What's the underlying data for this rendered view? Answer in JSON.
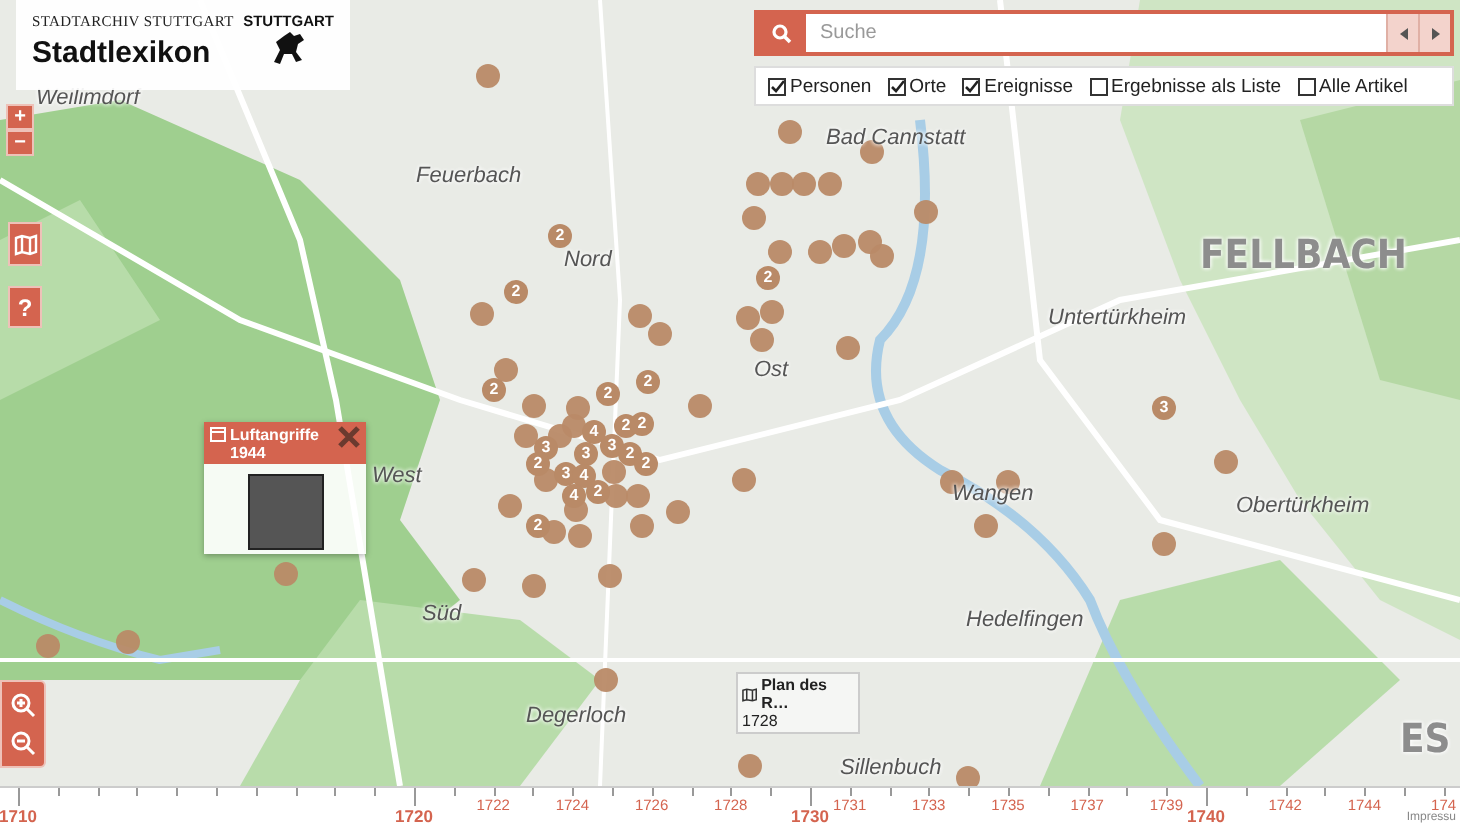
{
  "header": {
    "subtitle": "STADTARCHIV STUTTGART",
    "title": "Stadtlexikon",
    "logo_text": "STUTTGART"
  },
  "map_controls": {
    "zoom_in": "+",
    "zoom_out": "−",
    "help": "?"
  },
  "search": {
    "placeholder": "Suche"
  },
  "filters": [
    {
      "label": "Personen",
      "checked": true
    },
    {
      "label": "Orte",
      "checked": true
    },
    {
      "label": "Ereignisse",
      "checked": true
    },
    {
      "label": "Ergebnisse als Liste",
      "checked": false
    },
    {
      "label": "Alle Artikel",
      "checked": false
    }
  ],
  "place_labels": [
    {
      "text": "Weilimdorf",
      "kind": "district"
    },
    {
      "text": "Feuerbach",
      "kind": "district"
    },
    {
      "text": "Nord",
      "kind": "district"
    },
    {
      "text": "Bad Cannstatt",
      "kind": "district"
    },
    {
      "text": "FELLBACH",
      "kind": "city"
    },
    {
      "text": "Ost",
      "kind": "district"
    },
    {
      "text": "West",
      "kind": "district"
    },
    {
      "text": "Untertürkheim",
      "kind": "district"
    },
    {
      "text": "Obertürkheim",
      "kind": "district"
    },
    {
      "text": "Wangen",
      "kind": "district"
    },
    {
      "text": "Hedelfingen",
      "kind": "district"
    },
    {
      "text": "Süd",
      "kind": "district"
    },
    {
      "text": "Degerloch",
      "kind": "district"
    },
    {
      "text": "Sillenbuch",
      "kind": "district"
    },
    {
      "text": "ES",
      "kind": "city"
    }
  ],
  "clusters": [
    "2",
    "2",
    "2",
    "2",
    "2",
    "2",
    "3",
    "3",
    "4",
    "3",
    "2",
    "2",
    "2",
    "3",
    "4",
    "2",
    "4",
    "2",
    "2",
    "2",
    "3"
  ],
  "popup": {
    "title": "Luftangriffe",
    "year": "1944"
  },
  "map_tooltip": {
    "title": "Plan des R…",
    "year": "1728"
  },
  "timeline": {
    "labels": [
      {
        "text": "1710",
        "major": true
      },
      {
        "text": "1720",
        "major": true
      },
      {
        "text": "1722",
        "major": false
      },
      {
        "text": "1724",
        "major": false
      },
      {
        "text": "1726",
        "major": false
      },
      {
        "text": "1728",
        "major": false
      },
      {
        "text": "1730",
        "major": true
      },
      {
        "text": "1731",
        "major": false
      },
      {
        "text": "1733",
        "major": false
      },
      {
        "text": "1735",
        "major": false
      },
      {
        "text": "1737",
        "major": false
      },
      {
        "text": "1739",
        "major": false
      },
      {
        "text": "1740",
        "major": true
      },
      {
        "text": "1742",
        "major": false
      },
      {
        "text": "1744",
        "major": false
      },
      {
        "text": "174",
        "major": false
      }
    ],
    "footer_link": "Impressu"
  }
}
